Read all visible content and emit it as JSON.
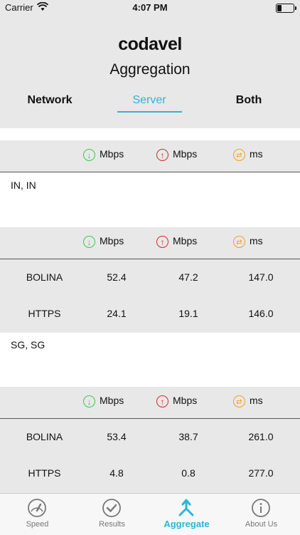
{
  "status_bar": {
    "carrier": "Carrier",
    "time": "4:07 PM"
  },
  "header": {
    "logo": "codavel",
    "title": "Aggregation"
  },
  "tabs": [
    {
      "label": "Network"
    },
    {
      "label": "Server",
      "active": true
    },
    {
      "label": "Both"
    }
  ],
  "columns": {
    "download": "Mbps",
    "upload": "Mbps",
    "latency": "ms"
  },
  "regions": [
    {
      "name": "IN, IN",
      "rows": []
    },
    {
      "name": "",
      "rows": [
        {
          "protocol": "BOLINA",
          "download": "52.4",
          "upload": "47.2",
          "latency": "147.0"
        },
        {
          "protocol": "HTTPS",
          "download": "24.1",
          "upload": "19.1",
          "latency": "146.0"
        }
      ]
    },
    {
      "name": "SG, SG",
      "rows": [
        {
          "protocol": "BOLINA",
          "download": "53.4",
          "upload": "38.7",
          "latency": "261.0"
        },
        {
          "protocol": "HTTPS",
          "download": "4.8",
          "upload": "0.8",
          "latency": "277.0"
        }
      ]
    }
  ],
  "tabbar": [
    {
      "label": "Speed",
      "icon": "speedometer-icon"
    },
    {
      "label": "Results",
      "icon": "checkmark-icon"
    },
    {
      "label": "Aggregate",
      "icon": "merge-arrows-icon",
      "active": true
    },
    {
      "label": "About Us",
      "icon": "info-icon"
    }
  ],
  "colors": {
    "accent": "#29b6d8",
    "download": "#3cc84b",
    "upload": "#cc2d2d",
    "latency": "#f0a21f"
  }
}
